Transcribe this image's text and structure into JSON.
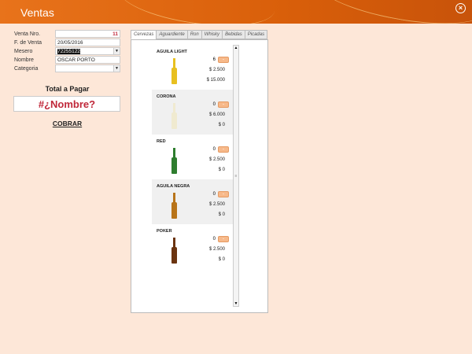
{
  "window": {
    "title": "Ventas"
  },
  "form": {
    "venta_nro_label": "Venta Nro.",
    "venta_nro": "11",
    "fecha_label": "F. de Venta",
    "fecha": "20/05/2016",
    "mesero_label": "Mesero",
    "mesero": "72255122",
    "nombre_label": "Nombre",
    "nombre": "OSCAR PORTO",
    "categoria_label": "Categoria",
    "categoria": ""
  },
  "total": {
    "label": "Total a Pagar",
    "value": "#¿Nombre?"
  },
  "cobrar_label": "COBRAR",
  "tabs": [
    "Cervezas",
    "Aguardiente",
    "Ron",
    "Whisky",
    "Bebidas",
    "Picadas"
  ],
  "products": [
    {
      "name": "AGUILA LIGHT",
      "qty": "6",
      "price": "$ 2.500",
      "subtotal": "$ 15.000",
      "color": "#e8c020"
    },
    {
      "name": "CORONA",
      "qty": "0",
      "price": "$ 6.000",
      "subtotal": "$ 0",
      "color": "#f0ead0"
    },
    {
      "name": "RED",
      "qty": "0",
      "price": "$ 2.500",
      "subtotal": "$ 0",
      "color": "#2e7d2e"
    },
    {
      "name": "AGUILA NEGRA",
      "qty": "0",
      "price": "$ 2.500",
      "subtotal": "$ 0",
      "color": "#b8741a"
    },
    {
      "name": "POKER",
      "qty": "0",
      "price": "$ 2.500",
      "subtotal": "$ 0",
      "color": "#6b3410"
    }
  ],
  "minus_label": "-"
}
